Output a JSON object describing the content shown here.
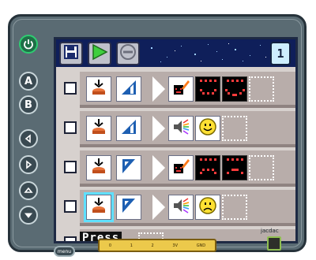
{
  "device": {
    "side_buttons": [
      "A",
      "B"
    ],
    "menu_label": "menu",
    "jacdac_label": "jacdac",
    "edge_connector_labels": [
      "0",
      "1",
      "2",
      "3V",
      "GND"
    ]
  },
  "toolbar": {
    "page_number": "1",
    "icons": [
      "save-icon",
      "play-icon",
      "disable-icon"
    ]
  },
  "rules": [
    {
      "checked": false,
      "when_sensor": "button-press",
      "when_filter": "bar-filter",
      "do_actuator": "screen",
      "do_params": [
        "smile-screen",
        "grin-screen"
      ]
    },
    {
      "checked": false,
      "when_sensor": "button-press",
      "when_filter": "bar-filter",
      "do_actuator": "speaker",
      "do_params": [
        "happy-sound"
      ]
    },
    {
      "checked": false,
      "when_sensor": "button-press",
      "when_filter": "flag-filter",
      "do_actuator": "screen",
      "do_params": [
        "sad-screen",
        "frown-screen"
      ]
    },
    {
      "checked": false,
      "when_sensor": "button-press",
      "when_filter": "flag-filter",
      "do_actuator": "speaker",
      "do_params": [
        "sad-sound"
      ]
    }
  ],
  "tooltip": {
    "text": "Press"
  },
  "colors": {
    "topbar": "#0f1f5a",
    "accent": "#2ecc71",
    "selection": "#5fe0ff",
    "rule_band": "#b8adaa"
  }
}
